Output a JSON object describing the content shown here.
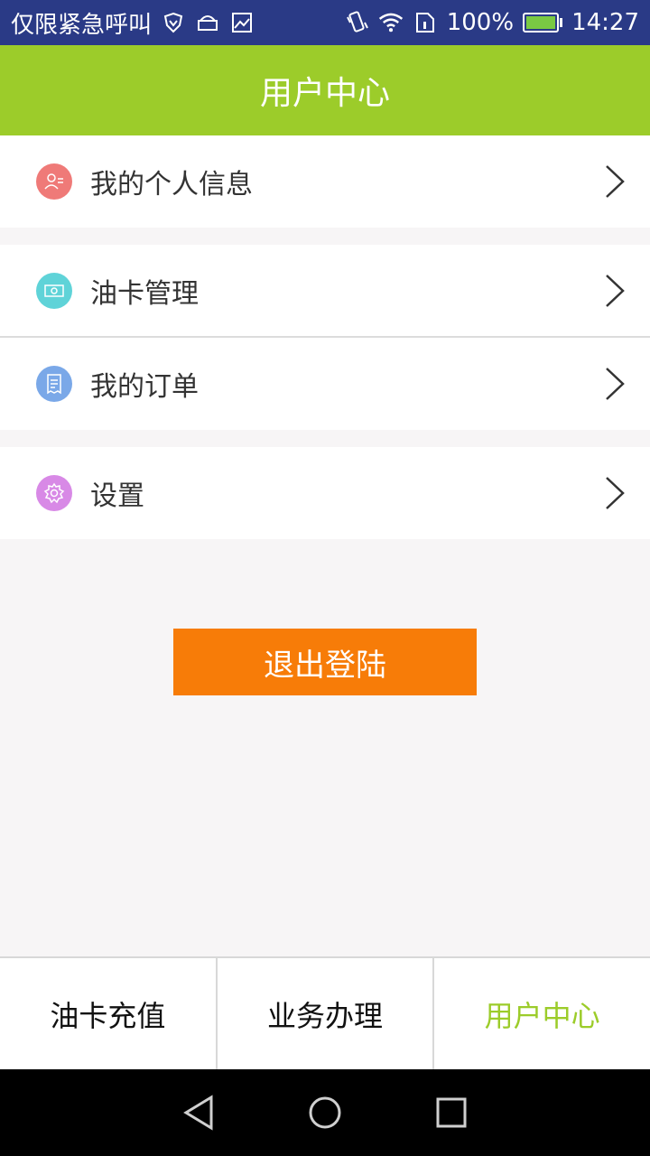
{
  "status_bar": {
    "carrier": "仅限紧急呼叫",
    "battery_text": "100%",
    "time": "14:27",
    "icons": [
      "shield-icon",
      "android-icon",
      "image-icon",
      "vibrate-icon",
      "wifi-icon",
      "sim-icon",
      "battery-icon"
    ]
  },
  "header": {
    "title": "用户中心"
  },
  "menu": {
    "items": [
      {
        "label": "我的个人信息",
        "icon": "user-info-icon",
        "icon_color": "#ef7a78"
      },
      {
        "label": "油卡管理",
        "icon": "card-icon",
        "icon_color": "#5fd3d8"
      },
      {
        "label": "我的订单",
        "icon": "order-icon",
        "icon_color": "#7aa8e8"
      },
      {
        "label": "设置",
        "icon": "settings-icon",
        "icon_color": "#d889e6"
      }
    ]
  },
  "logout_label": "退出登陆",
  "tabs": [
    {
      "label": "油卡充值",
      "active": false
    },
    {
      "label": "业务办理",
      "active": false
    },
    {
      "label": "用户中心",
      "active": true
    }
  ],
  "colors": {
    "accent_green": "#9ccc2a",
    "logout_orange": "#f77c08",
    "status_bar": "#2a3a86"
  },
  "nav": [
    "back-icon",
    "home-icon",
    "recents-icon"
  ]
}
